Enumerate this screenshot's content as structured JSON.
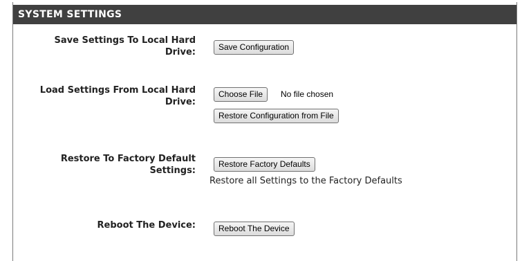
{
  "section": {
    "title": "SYSTEM SETTINGS"
  },
  "save": {
    "label": "Save Settings To Local Hard Drive:",
    "button": "Save Configuration"
  },
  "load": {
    "label": "Load Settings From Local Hard Drive:",
    "choose_button": "Choose File",
    "file_status": "No file chosen",
    "restore_button": "Restore Configuration from File"
  },
  "factory": {
    "label": "Restore To Factory Default Settings:",
    "button": "Restore Factory Defaults",
    "note": "Restore all Settings to the Factory Defaults"
  },
  "reboot": {
    "label": "Reboot The Device:",
    "button": "Reboot The Device"
  }
}
